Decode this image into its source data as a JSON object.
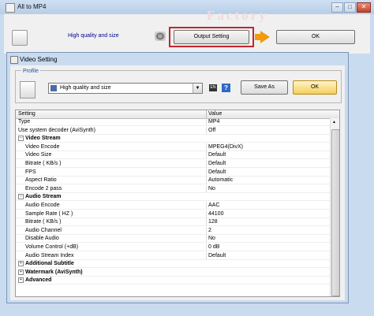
{
  "outer_window": {
    "title": "All to MP4",
    "watermark": "Factory",
    "preset_label": "High quality and size",
    "output_setting_button": "Output Setting",
    "ok_button": "OK",
    "caption_buttons": [
      "–",
      "□",
      "✕"
    ]
  },
  "video_setting": {
    "title": "Video Setting",
    "profile_legend": "Profile",
    "profile_value": "High quality and size",
    "save_as_button": "Save As",
    "ok_button": "OK",
    "help_icon": "?",
    "edit_icon": "EN"
  },
  "grid": {
    "headers": {
      "setting": "Setting",
      "value": "Value"
    },
    "rows": [
      {
        "setting": "Type",
        "value": "MP4",
        "indent": 0
      },
      {
        "setting": "Use system decoder (AviSynth)",
        "value": "Off",
        "indent": 0
      },
      {
        "setting": "Video Stream",
        "value": "",
        "category": true,
        "expander": "−"
      },
      {
        "setting": "Video Encode",
        "value": "MPEG4(DivX)",
        "indent": 1
      },
      {
        "setting": "Video Size",
        "value": "Default",
        "indent": 1
      },
      {
        "setting": "Bitrate ( KB/s )",
        "value": "Default",
        "indent": 1
      },
      {
        "setting": "FPS",
        "value": "Default",
        "indent": 1
      },
      {
        "setting": "Aspect Ratio",
        "value": "Automatic",
        "indent": 1
      },
      {
        "setting": "Encode 2 pass",
        "value": "No",
        "indent": 1
      },
      {
        "setting": "Audio Stream",
        "value": "",
        "category": true,
        "expander": "−"
      },
      {
        "setting": "Audio Encode",
        "value": "AAC",
        "indent": 1
      },
      {
        "setting": "Sample Rate ( HZ )",
        "value": "44100",
        "indent": 1
      },
      {
        "setting": "Bitrate ( KB/s )",
        "value": "128",
        "indent": 1
      },
      {
        "setting": "Audio Channel",
        "value": "2",
        "indent": 1
      },
      {
        "setting": "Disable Audio",
        "value": "No",
        "indent": 1
      },
      {
        "setting": "Volume Control (+dB)",
        "value": "0 dB",
        "indent": 1
      },
      {
        "setting": "Audio Stream Index",
        "value": "Default",
        "indent": 1
      },
      {
        "setting": "Additional Subtitle",
        "value": "",
        "category": true,
        "expander": "+"
      },
      {
        "setting": "Watermark (AviSynth)",
        "value": "",
        "category": true,
        "expander": "+"
      },
      {
        "setting": "Advanced",
        "value": "",
        "category": true,
        "expander": "+"
      }
    ]
  },
  "colors": {
    "accent_red": "#c1272d",
    "ok_highlight": "#f5cf5a",
    "arrow": "#f29a0e",
    "label_blue": "#00008b"
  }
}
